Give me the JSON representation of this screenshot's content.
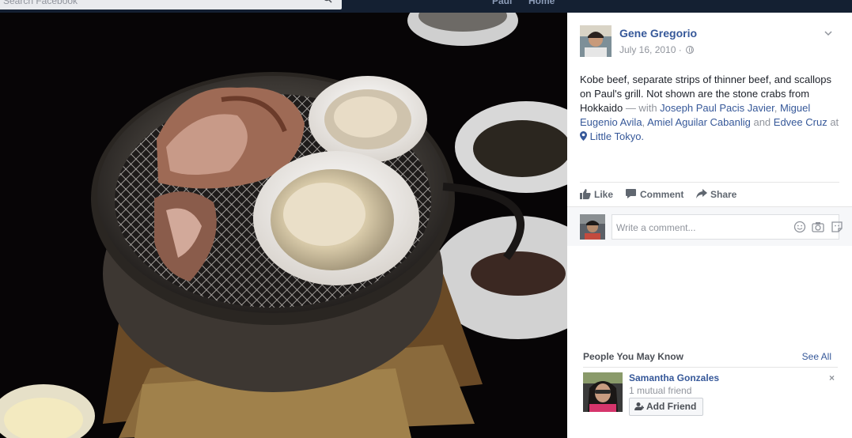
{
  "topbar": {
    "search_placeholder": "Search Facebook",
    "nav_profile": "Paul",
    "nav_home": "Home"
  },
  "photo": {
    "description_icon": "grill-photo"
  },
  "post": {
    "author": "Gene Gregorio",
    "date": "July 16, 2010 ·",
    "text_main": "Kobe beef, separate strips of thinner beef, and scallops on Paul's grill. Not shown are the stone crabs from Hokkaido",
    "with_label": " — with ",
    "tag_1": "Joseph Paul Pacis Javier",
    "sep_1": ", ",
    "tag_2": "Miguel Eugenio Avila",
    "sep_2": ", ",
    "tag_3": "Amiel Aguilar Cabanlig",
    "and_label": " and ",
    "tag_4": "Edvee Cruz",
    "at_label": " at ",
    "location": "Little Tokyo."
  },
  "actions": {
    "like": "Like",
    "comment": "Comment",
    "share": "Share"
  },
  "comment_box": {
    "placeholder": "Write a comment..."
  },
  "pymk": {
    "title": "People You May Know",
    "see_all": "See All",
    "person_name": "Samantha Gonzales",
    "mutual": "1 mutual friend",
    "add_friend": "Add Friend",
    "close": "×"
  },
  "colors": {
    "link": "#365899",
    "muted": "#90949c",
    "text": "#1d2129"
  }
}
